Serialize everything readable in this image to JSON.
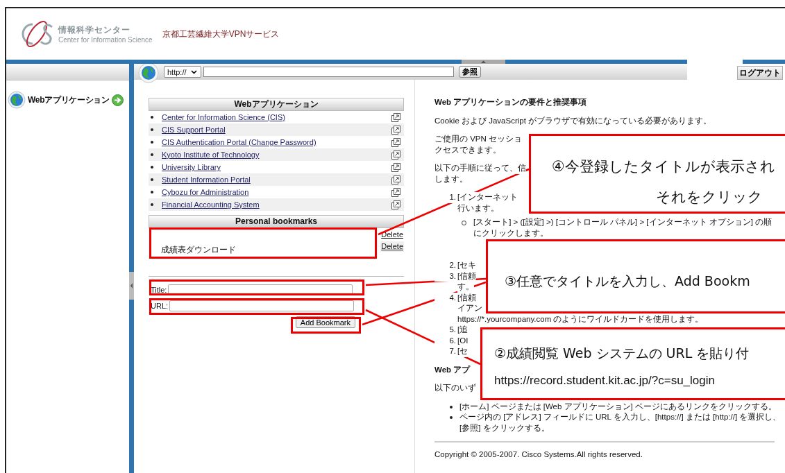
{
  "header": {
    "org_name": "情報科学センター",
    "org_name_en": "Center for Information Science",
    "service_title": "京都工芸繊維大学VPNサービス"
  },
  "toolbar": {
    "protocol": "http://",
    "browse_button": "参照",
    "logout_button": "ログアウト"
  },
  "sidebar": {
    "items": [
      {
        "label": "Webアプリケーション"
      }
    ]
  },
  "web_applications": {
    "heading": "Webアプリケーション",
    "items": [
      {
        "label": "Center for Information Science (CIS)"
      },
      {
        "label": "CIS Support Portal"
      },
      {
        "label": "CIS Authentication Portal (Change Password)"
      },
      {
        "label": "Kyoto Institute of Technology"
      },
      {
        "label": "University Library"
      },
      {
        "label": "Student Information Portal"
      },
      {
        "label": "Cybozu for Administration"
      },
      {
        "label": "Financial Accounting System"
      }
    ]
  },
  "bookmarks": {
    "heading": "Personal bookmarks",
    "rows": [
      {
        "delete": "Delete"
      },
      {
        "title": "成績表ダウンロード",
        "delete": "Delete"
      }
    ]
  },
  "add_form": {
    "title_label": "Title:",
    "url_label": "URL:",
    "button": "Add Bookmark"
  },
  "info": [
    {
      "kind": "heading",
      "lines": [
        "Web アプリケーションの要件と推奨事項"
      ]
    },
    {
      "kind": "para",
      "lines": [
        "Cookie および JavaScript がブラウザで有効になっている必要があります。"
      ]
    },
    {
      "kind": "para",
      "lines": [
        "ご使用の VPN セッショ",
        "クセスできます。"
      ]
    },
    {
      "kind": "para",
      "lines": [
        "以下の手順に従って、信",
        "します。"
      ]
    },
    {
      "kind": "steps",
      "steps": [
        {
          "number": "1.",
          "lines": [
            "[インターネット",
            "行います。"
          ],
          "sub": [
            {
              "lines": [
                "[スタート] > ([設定] >) [コントロール パネル] > [インターネット オプション] の順",
                "にクリックします。"
              ]
            }
          ]
        },
        {
          "number": "2.",
          "lines": [
            "[セキ"
          ]
        },
        {
          "number": "3.",
          "lines": [
            "[信頼",
            "す。"
          ]
        },
        {
          "number": "4.",
          "lines": [
            "[信頼",
            "イアン",
            "https://*.yourcompany.com のようにワイルドカードを使用します。"
          ]
        },
        {
          "number": "5.",
          "lines": [
            "[追"
          ]
        },
        {
          "number": "6.",
          "lines": [
            "[OI"
          ]
        },
        {
          "number": "7.",
          "lines": [
            "[セ"
          ]
        }
      ]
    },
    {
      "kind": "heading",
      "lines": [
        "Web アプ"
      ]
    },
    {
      "kind": "para",
      "lines": [
        "以下のいず"
      ]
    },
    {
      "kind": "bullets",
      "items": [
        {
          "lines": [
            "[ホーム] ページまたは [Web アプリケーション] ページにあるリンクをクリックする。"
          ]
        },
        {
          "lines": [
            "ページ内の [アドレス] フィールドに URL を入力し、[https://] または [http://] を選択し、",
            "[参照] をクリックする。"
          ]
        }
      ]
    },
    {
      "kind": "rule"
    },
    {
      "kind": "para",
      "lines": [
        "Copyright © 2005-2007. Cisco Systems.All rights reserved."
      ]
    }
  ],
  "annotations": [
    {
      "lines": [
        "④今登録したタイトルが表示され",
        "それをクリック"
      ]
    },
    {
      "lines": [
        "③任意でタイトルを入力し、Add Bookm"
      ]
    },
    {
      "lines": [
        "②成績閲覧 Web システムの URL を貼り付",
        "https://record.student.kit.ac.jp/?c=su_login"
      ]
    }
  ]
}
